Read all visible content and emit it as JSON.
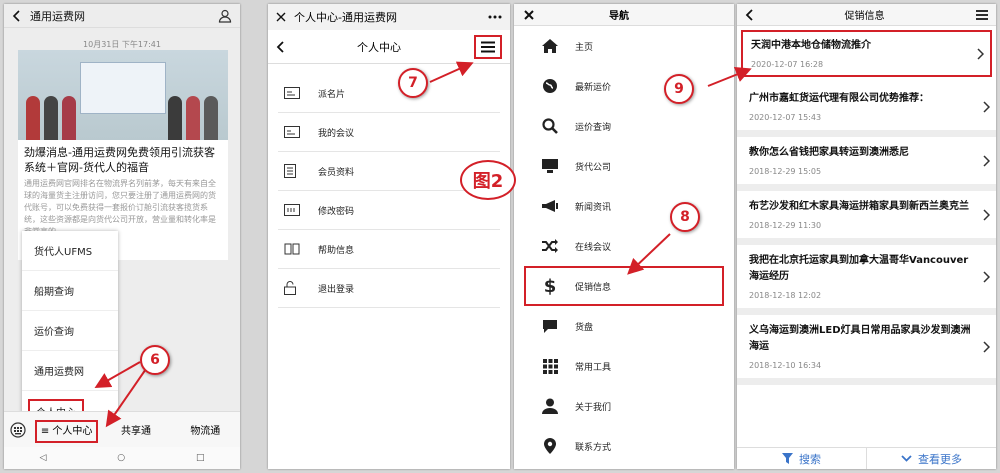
{
  "panel1": {
    "title": "通用运费网",
    "timestamp": "10月31日 下午17:41",
    "card_title": "劲爆消息-通用运费网免费领用引流获客系统＋官网-货代人的福音",
    "card_desc": "通用运费网官网排名在物流界名列前茅，每天有来自全球的海量货主注册访问，您只要注册了通用运费网的货代账号，可以免费获得一套报价订舱引流获客揽货系统，这些资源都是向货代公司开放，营业量和转化率是非常高的。",
    "popup_menu": [
      "货代人UFMS",
      "船期查询",
      "运价查询",
      "通用运费网",
      "个人中心"
    ],
    "tabs": [
      "≡ 个人中心",
      "共享通",
      "物流通"
    ]
  },
  "panel2": {
    "wechat_title": "个人中心-通用运费网",
    "header_title": "个人中心",
    "items": [
      "派名片",
      "我的会议",
      "会员资料",
      "修改密码",
      "帮助信息",
      "退出登录"
    ]
  },
  "panel3": {
    "title": "导航",
    "items": [
      "主页",
      "最新运价",
      "运价查询",
      "货代公司",
      "新闻资讯",
      "在线会议",
      "促销信息",
      "货盘",
      "常用工具",
      "关于我们",
      "联系方式"
    ]
  },
  "panel4": {
    "title": "促销信息",
    "news": [
      {
        "title": "天润中港本地仓储物流推介",
        "date": "2020-12-07 16:28"
      },
      {
        "title": "广州市嘉虹货运代理有限公司优势推荐：",
        "date": "2020-12-07 15:43"
      },
      {
        "title": "教你怎么省钱把家具转运到澳洲悉尼",
        "date": "2018-12-29 15:05"
      },
      {
        "title": "布艺沙发和红木家具海运拼箱家具到新西兰奥克兰",
        "date": "2018-12-29 11:30"
      },
      {
        "title": "我把在北京托运家具到加拿大温哥华Vancouver海运经历",
        "date": "2018-12-18 12:02"
      },
      {
        "title": "义乌海运到澳洲LED灯具日常用品家具沙发到澳洲海运",
        "date": "2018-12-10 16:34"
      }
    ],
    "footer_search": "搜索",
    "footer_more": "查看更多"
  },
  "annotations": {
    "step6": "6",
    "step7": "7",
    "step8": "8",
    "step9": "9",
    "figure_label": "图2"
  },
  "colors": {
    "accent_red": "#d32028",
    "link_blue": "#3a74c9"
  }
}
